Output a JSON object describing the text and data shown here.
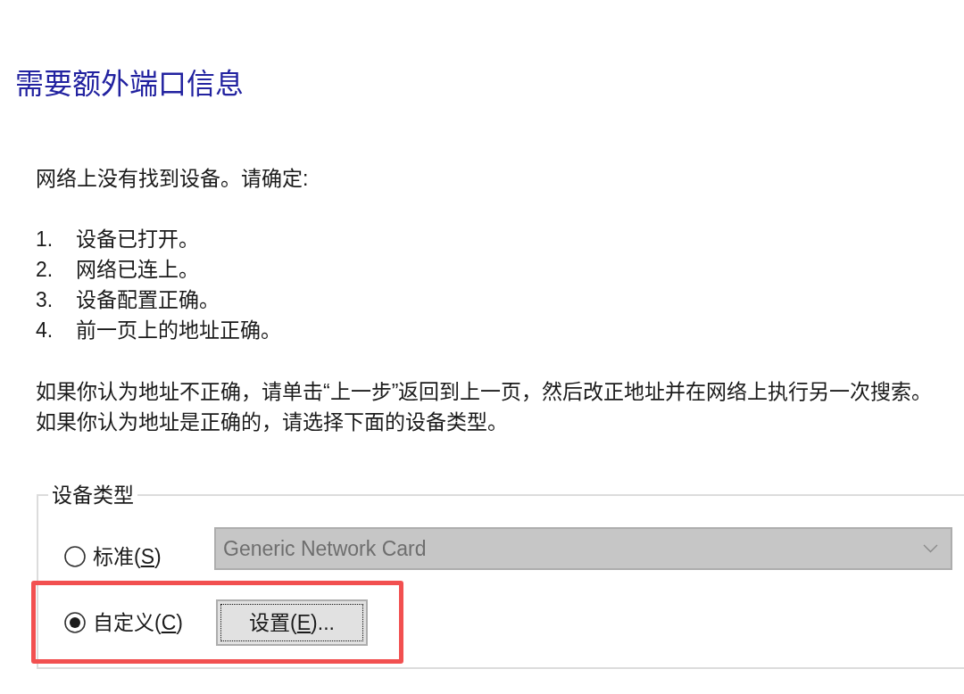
{
  "heading": "需要额外端口信息",
  "intro": "网络上没有找到设备。请确定:",
  "checklist": [
    {
      "number": "1.",
      "text": "设备已打开。"
    },
    {
      "number": "2.",
      "text": "网络已连上。"
    },
    {
      "number": "3.",
      "text": "设备配置正确。"
    },
    {
      "number": "4.",
      "text": "前一页上的地址正确。"
    }
  ],
  "notes": [
    "如果你认为地址不正确，请单击“上一步”返回到上一页，然后改正地址并在网络上执行另一次搜索。",
    "如果你认为地址是正确的，请选择下面的设备类型。"
  ],
  "device_type": {
    "title": "设备类型",
    "options": [
      {
        "kind": "dropdown",
        "label": "标准(",
        "access_key": "S",
        "label_end": ")",
        "selected": false,
        "highlighted": false,
        "dropdown": {
          "value": "Generic Network Card",
          "disabled": true
        }
      },
      {
        "kind": "button",
        "label": "自定义(",
        "access_key": "C",
        "label_end": ")",
        "selected": true,
        "highlighted": true,
        "button": {
          "label": "设置(",
          "access_key": "E",
          "label_end": ")...",
          "focused": true
        }
      }
    ]
  }
}
